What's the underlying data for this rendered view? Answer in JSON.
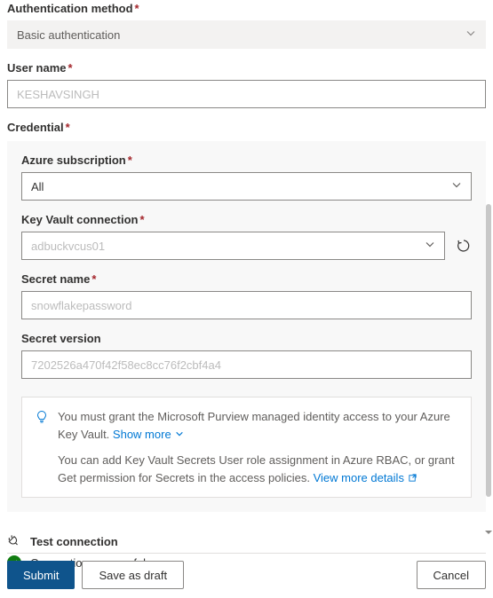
{
  "authMethod": {
    "label": "Authentication method",
    "value": "Basic authentication"
  },
  "userName": {
    "label": "User name",
    "placeholder": "KESHAVSINGH"
  },
  "credential": {
    "label": "Credential",
    "subscription": {
      "label": "Azure subscription",
      "value": "All"
    },
    "keyVault": {
      "label": "Key Vault connection",
      "placeholder": "adbuckvcus01"
    },
    "secretName": {
      "label": "Secret name",
      "placeholder": "snowflakepassword"
    },
    "secretVersion": {
      "label": "Secret version",
      "placeholder": "7202526a470f42f58ec8cc76f2cbf4a4"
    }
  },
  "infoBox": {
    "line1": "You must grant the Microsoft Purview managed identity access to your Azure Key Vault.",
    "showMore": "Show more",
    "line2": "You can add Key Vault Secrets User role assignment in Azure RBAC, or grant Get permission for Secrets in the access policies.",
    "viewMore": "View more details"
  },
  "testConnection": {
    "title": "Test connection",
    "result": "Connection successful."
  },
  "footer": {
    "submit": "Submit",
    "saveDraft": "Save as draft",
    "cancel": "Cancel"
  },
  "requiredMark": "*"
}
